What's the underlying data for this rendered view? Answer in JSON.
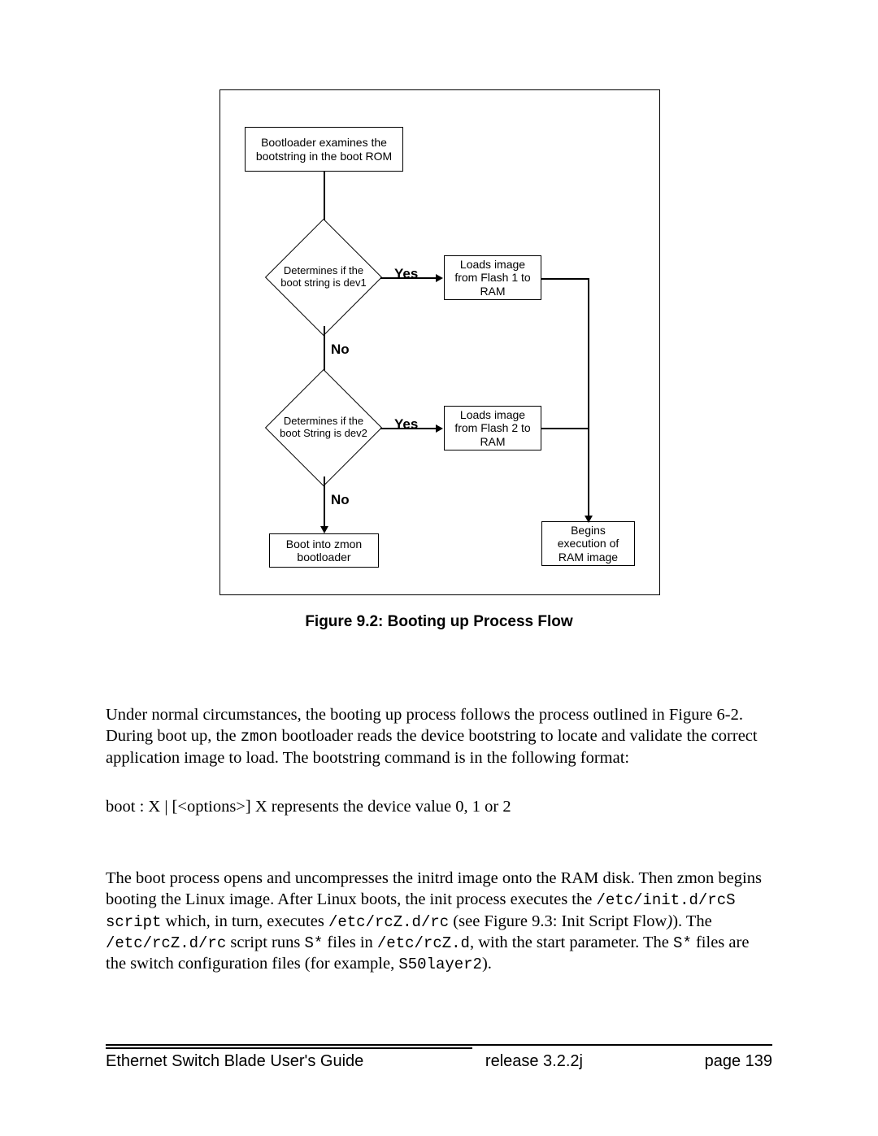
{
  "figure": {
    "caption": "Figure 9.2:  Booting up Process Flow",
    "boxes": {
      "start": "Bootloader examines the bootstring in the boot ROM",
      "d1": "Determines if the boot string is dev1",
      "d2": "Determines if the boot String is dev2",
      "load1": "Loads image from Flash 1 to RAM",
      "load2": "Loads image from Flash 2 to RAM",
      "zmon": "Boot into zmon bootloader",
      "ram": "Begins execution of RAM image"
    },
    "labels": {
      "yes": "Yes",
      "no": "No"
    }
  },
  "para1": {
    "t1": "Under normal circumstances, the booting up process follows the process outlined in Figure 6-2. During boot up, the ",
    "code1": "zmon",
    "t2": " bootloader reads the device bootstring to locate and validate the correct application image to load. The bootstring command is in the following format:"
  },
  "bootline": "boot : X | [<options>]    X represents the device value 0, 1 or 2",
  "para2": {
    "t1": "The boot process opens and uncompresses the initrd image onto the RAM disk. Then zmon begins booting the Linux image. After Linux boots, the init process executes the ",
    "code1": "/etc/init.d/rcS script",
    "t2": " which, in turn, executes ",
    "code2": "/etc/rcZ.d/rc",
    "t3": " (see Figure 9.3: Init Script Flow",
    "italic1": ")",
    "t4": "). The ",
    "code3": "/etc/rcZ.d/rc",
    "t5": " script runs ",
    "code4": "S*",
    "t6": " files in ",
    "code5": "/etc/rcZ.d",
    "t7": ", with the start parameter. The ",
    "code6": "S*",
    "t8": " files are the switch configuration files (for example, ",
    "code7": "S50layer2",
    "t9": ")."
  },
  "footer": {
    "left": "Ethernet Switch Blade User's Guide",
    "center": "release  3.2.2j",
    "right": "page 139"
  }
}
